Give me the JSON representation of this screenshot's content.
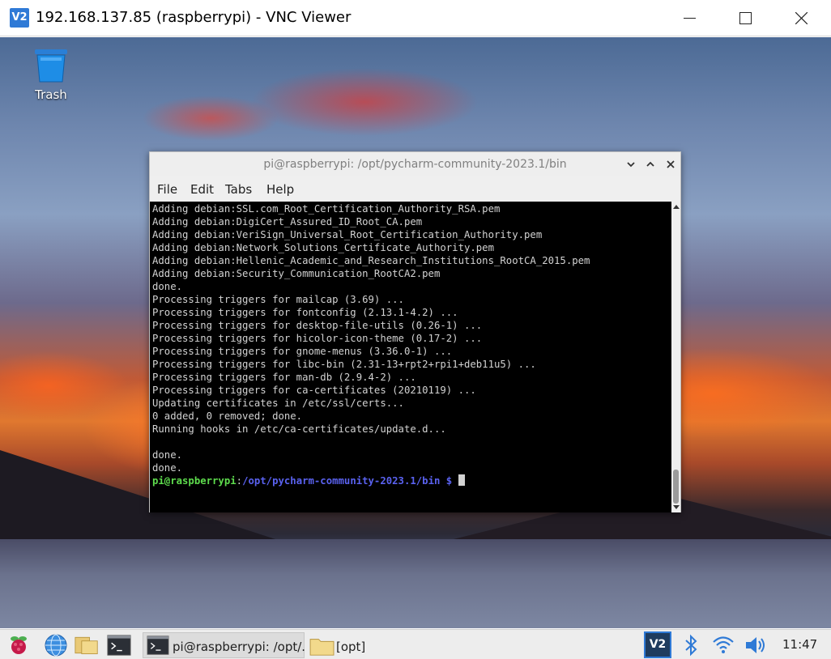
{
  "vnc": {
    "logo": "V2",
    "title": "192.168.137.85 (raspberrypi) - VNC Viewer"
  },
  "desktop": {
    "trash_label": "Trash"
  },
  "terminal": {
    "title": "pi@raspberrypi: /opt/pycharm-community-2023.1/bin",
    "menu": [
      "File",
      "Edit",
      "Tabs",
      "Help"
    ],
    "lines": [
      "Adding debian:SSL.com_Root_Certification_Authority_RSA.pem",
      "Adding debian:DigiCert_Assured_ID_Root_CA.pem",
      "Adding debian:VeriSign_Universal_Root_Certification_Authority.pem",
      "Adding debian:Network_Solutions_Certificate_Authority.pem",
      "Adding debian:Hellenic_Academic_and_Research_Institutions_RootCA_2015.pem",
      "Adding debian:Security_Communication_RootCA2.pem",
      "done.",
      "Processing triggers for mailcap (3.69) ...",
      "Processing triggers for fontconfig (2.13.1-4.2) ...",
      "Processing triggers for desktop-file-utils (0.26-1) ...",
      "Processing triggers for hicolor-icon-theme (0.17-2) ...",
      "Processing triggers for gnome-menus (3.36.0-1) ...",
      "Processing triggers for libc-bin (2.31-13+rpt2+rpi1+deb11u5) ...",
      "Processing triggers for man-db (2.9.4-2) ...",
      "Processing triggers for ca-certificates (20210119) ...",
      "Updating certificates in /etc/ssl/certs...",
      "0 added, 0 removed; done.",
      "Running hooks in /etc/ca-certificates/update.d...",
      "",
      "done.",
      "done."
    ],
    "prompt_user": "pi@raspberrypi",
    "prompt_sep": ":",
    "prompt_path": "/opt/pycharm-community-2023.1/bin $",
    "colors": {
      "user": "#5edc4d",
      "path": "#5a62f0",
      "text": "#d2d2d2",
      "background": "#000000"
    }
  },
  "taskbar": {
    "tasks": [
      {
        "label": "pi@raspberrypi: /opt/..."
      },
      {
        "label": "[opt]"
      }
    ],
    "vnc_tray": "V2",
    "clock": "11:47"
  }
}
